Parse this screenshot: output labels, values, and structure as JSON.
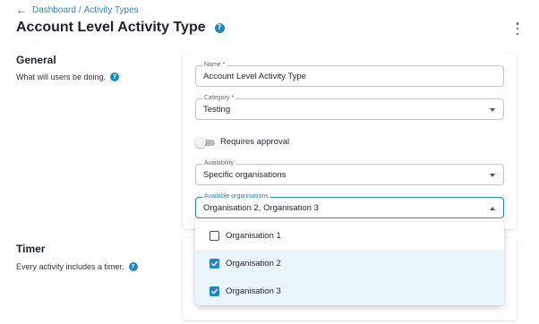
{
  "breadcrumb": {
    "items": [
      "Dashboard",
      "Activity Types"
    ],
    "separator": "/"
  },
  "page": {
    "title": "Account Level Activity Type",
    "help": "?"
  },
  "general": {
    "heading": "General",
    "description": "What will users be doing.",
    "help": "?"
  },
  "form": {
    "name": {
      "label": "Name *",
      "value": "Account Level Activity Type"
    },
    "category": {
      "label": "Category *",
      "value": "Testing"
    },
    "requires_approval": {
      "label": "Requires approval",
      "on": false
    },
    "availability": {
      "label": "Availability",
      "value": "Specific organisations"
    },
    "available_organisations": {
      "label": "Available organisations",
      "value": "Organisation 2, Organisation 3"
    }
  },
  "organisations_dropdown": {
    "options": [
      {
        "label": "Organisation 1",
        "checked": false
      },
      {
        "label": "Organisation 2",
        "checked": true
      },
      {
        "label": "Organisation 3",
        "checked": true
      }
    ]
  },
  "timer": {
    "heading": "Timer",
    "description": "Every activity includes a timer.",
    "help": "?"
  },
  "icons": {
    "back": "arrow-left-icon",
    "help": "question-circle-icon",
    "more": "kebab-menu-icon",
    "caret": "caret-icon",
    "check": "check-icon"
  },
  "colors": {
    "accent": "#1e88c7",
    "selected_option_bg": "#eaf4fb",
    "toggle_track": "#b9b9b9"
  }
}
